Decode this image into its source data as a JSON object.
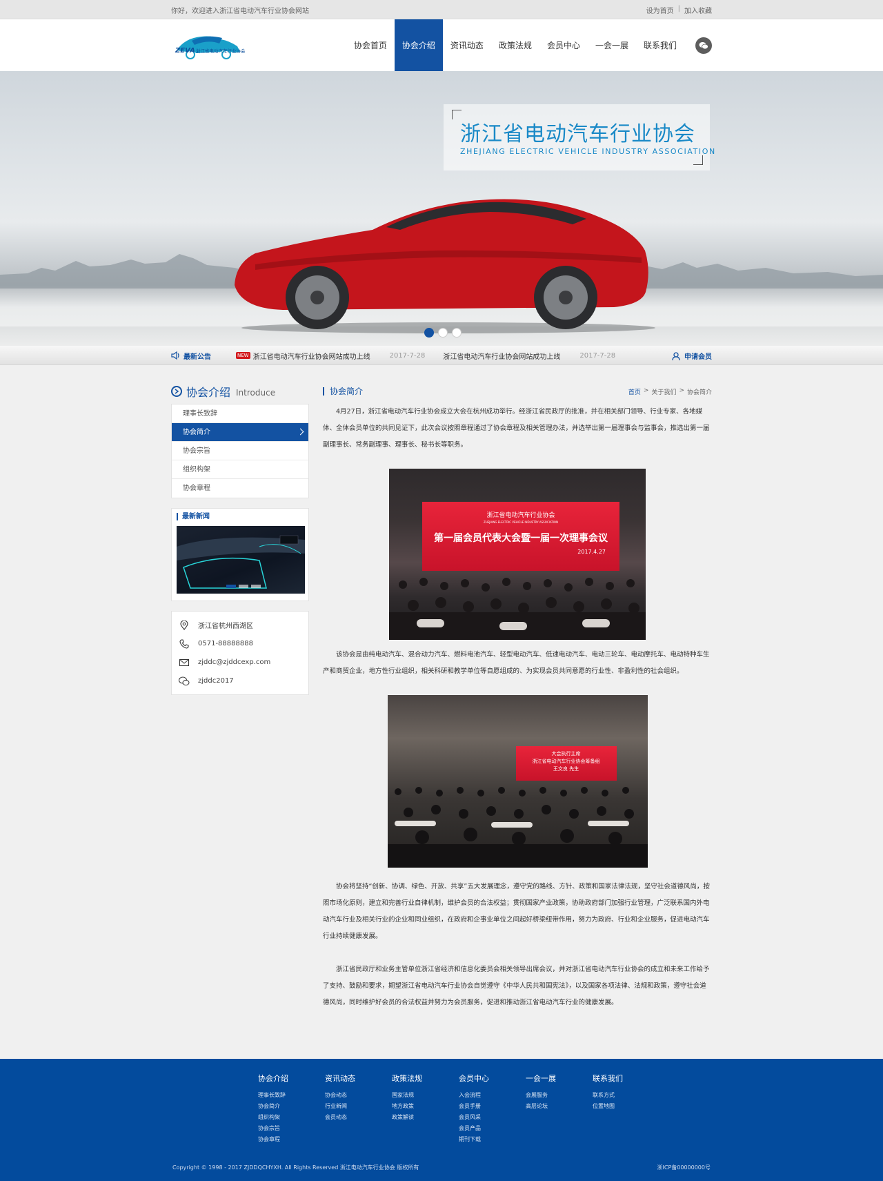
{
  "topbar": {
    "welcome": "你好，欢迎进入浙江省电动汽车行业协会网站",
    "set_home": "设为首页",
    "separator": "|",
    "favorite": "加入收藏"
  },
  "header": {
    "logo_text": "ZEVA",
    "logo_sub": "浙江省电动汽车行业协会",
    "nav": [
      {
        "label": "协会首页"
      },
      {
        "label": "协会介绍"
      },
      {
        "label": "资讯动态"
      },
      {
        "label": "政策法规"
      },
      {
        "label": "会员中心"
      },
      {
        "label": "一会一展"
      },
      {
        "label": "联系我们"
      }
    ],
    "active_nav": "协会介绍",
    "accent": "#1352a2"
  },
  "banner": {
    "title_cn": "浙江省电动汽车行业协会",
    "title_en": "ZHEJIANG ELECTRIC VEHICLE INDUSTRY ASSOCIATION",
    "slides": 3,
    "active_slide": 1
  },
  "notice": {
    "label": "最新公告",
    "badge": "NEW",
    "items": [
      {
        "text": "浙江省电动汽车行业协会网站成功上线",
        "date": "2017-7-28"
      },
      {
        "text": "浙江省电动汽车行业协会网站成功上线",
        "date": "2017-7-28"
      }
    ],
    "apply": "申请会员"
  },
  "sidebar": {
    "title_cn": "协会介绍",
    "title_en": "Introduce",
    "items": [
      {
        "label": "理事长致辞"
      },
      {
        "label": "协会简介"
      },
      {
        "label": "协会宗旨"
      },
      {
        "label": "组织构架"
      },
      {
        "label": "协会章程"
      }
    ],
    "active_item": "协会简介",
    "news_title": "最新新闻",
    "contact": {
      "address": "浙江省杭州西湖区",
      "phone": "0571-88888888",
      "email": "zjddc@zjddcexp.com",
      "wechat": "zjddc2017"
    }
  },
  "content": {
    "title": "协会简介",
    "breadcrumb": {
      "home": "首页",
      "sep1": ">",
      "parent": "关于我们",
      "sep2": ">",
      "current": "协会简介"
    },
    "p1": "4月27日，浙江省电动汽车行业协会成立大会在杭州成功举行。经浙江省民政厅的批准，并在相关部门领导、行业专家、各地媒体、全体会员单位的共同见证下，此次会议按照章程通过了协会章程及相关管理办法，并选举出第一届理事会与监事会，推选出第一届副理事长、常务副理事、理事长、秘书长等职务。",
    "pic1": {
      "logo": "浙江省电动汽车行业协会",
      "logo_en": "ZHEJIANG ELECTRIC VEHICLE INDUSTRY ASSOCIATION",
      "headline": "第一届会员代表大会暨一届一次理事会议",
      "date": "2017.4.27"
    },
    "p2": "该协会是由纯电动汽车、混合动力汽车、燃料电池汽车、轻型电动汽车、低速电动汽车、电动三轮车、电动摩托车、电动特种车生产和商贸企业，地方性行业组织，相关科研和教学单位等自愿组成的、为实现会员共同意愿的行业性、非盈利性的社会组织。",
    "pic2": {
      "line1": "大会执行主席",
      "line2": "浙江省电动汽车行业协会筹备组",
      "line3": "王文良 先生"
    },
    "p3": "协会将坚持“创新、协调、绿色、开放、共享”五大发展理念，遵守党的路线、方针、政策和国家法律法规，坚守社会道德风尚，按照市场化原则，建立和完善行业自律机制，维护会员的合法权益；贯彻国家产业政策，协助政府部门加强行业管理，广泛联系国内外电动汽车行业及相关行业的企业和同业组织，在政府和企事业单位之间起好桥梁纽带作用，努力为政府、行业和企业服务，促进电动汽车行业持续健康发展。",
    "p4": "浙江省民政厅和业务主管单位浙江省经济和信息化委员会相关领导出席会议，并对浙江省电动汽车行业协会的成立和未来工作给予了支持、鼓励和要求，期望浙江省电动汽车行业协会自觉遵守《中华人民共和国宪法》，以及国家各项法律、法规和政策，遵守社会道德风尚，同时维护好会员的合法权益并努力为会员服务，促进和推动浙江省电动汽车行业的健康发展。"
  },
  "footer": {
    "columns": [
      {
        "title": "协会介绍",
        "links": [
          "理事长致辞",
          "协会简介",
          "组织构架",
          "协会宗旨",
          "协会章程"
        ]
      },
      {
        "title": "资讯动态",
        "links": [
          "协会动态",
          "行业新闻",
          "会员动态"
        ]
      },
      {
        "title": "政策法规",
        "links": [
          "国家法规",
          "地方政策",
          "政策解读"
        ]
      },
      {
        "title": "会员中心",
        "links": [
          "入会流程",
          "会员手册",
          "会员风采",
          "会员产品",
          "期刊下载"
        ]
      },
      {
        "title": "一会一展",
        "links": [
          "会展服务",
          "高层论坛"
        ]
      },
      {
        "title": "联系我们",
        "links": [
          "联系方式",
          "位置地图"
        ]
      }
    ],
    "copyright": "Copyright © 1998 - 2017 ZJDDQCHYXH. All Rights Reserved 浙江电动汽车行业协会 版权所有",
    "icp": "浙ICP备00000000号",
    "bg": "#034b9d"
  }
}
